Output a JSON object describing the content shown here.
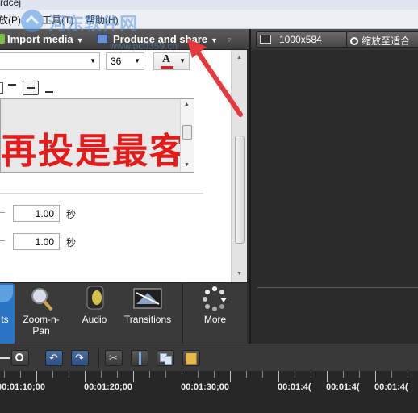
{
  "window": {
    "title": "rdcej"
  },
  "menu": {
    "items": [
      {
        "label": "放(P)"
      },
      {
        "label": "工具(T)"
      },
      {
        "label": "帮助(H)"
      }
    ]
  },
  "toolbar": {
    "import_media": "Import media",
    "produce_share": "Produce and share"
  },
  "preview": {
    "dimensions": "1000x584",
    "zoom_label": "缩放至适合"
  },
  "text_props": {
    "font_size": "36",
    "text_content": "再投是最客",
    "text_color": "#e31b1b",
    "fade_in": "1.00",
    "fade_out": "1.00",
    "unit": "秒"
  },
  "tabs": [
    {
      "label": "ts",
      "icon": "callouts-icon"
    },
    {
      "label": "Zoom-n-\nPan",
      "icon": "magnifier-icon"
    },
    {
      "label": "Audio",
      "icon": "speaker-icon"
    },
    {
      "label": "Transitions",
      "icon": "transitions-icon"
    },
    {
      "label": "More",
      "icon": "more-dots-icon"
    }
  ],
  "timeline": {
    "labels": [
      "00:01:10;00",
      "00:01:20;00",
      "00:01:30;00",
      "00:01:4(",
      "00:01:4(",
      "00:01:4("
    ]
  },
  "watermark": {
    "title": "河东软件网",
    "url": "www.pc0359.cn"
  },
  "colors": {
    "accent_arrow": "#e8383d",
    "dark_panel": "#2b2b2b"
  }
}
